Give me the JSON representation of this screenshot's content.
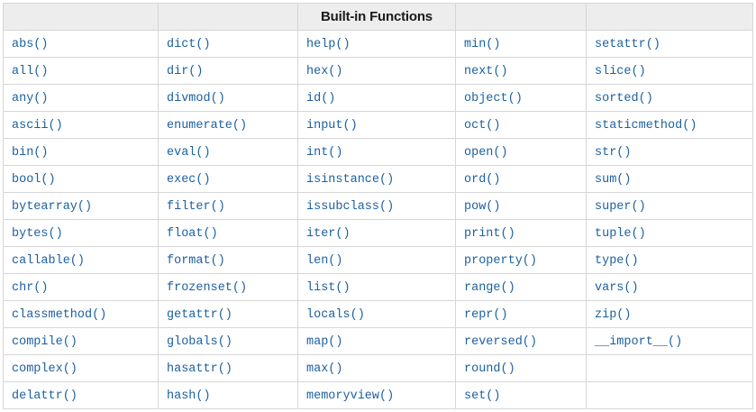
{
  "table": {
    "title": "Built-in Functions",
    "link_color": "#1c60a0",
    "header_background": "#ededed",
    "border_color": "#d6d6d6",
    "rows": [
      [
        "abs()",
        "dict()",
        "help()",
        "min()",
        "setattr()"
      ],
      [
        "all()",
        "dir()",
        "hex()",
        "next()",
        "slice()"
      ],
      [
        "any()",
        "divmod()",
        "id()",
        "object()",
        "sorted()"
      ],
      [
        "ascii()",
        "enumerate()",
        "input()",
        "oct()",
        "staticmethod()"
      ],
      [
        "bin()",
        "eval()",
        "int()",
        "open()",
        "str()"
      ],
      [
        "bool()",
        "exec()",
        "isinstance()",
        "ord()",
        "sum()"
      ],
      [
        "bytearray()",
        "filter()",
        "issubclass()",
        "pow()",
        "super()"
      ],
      [
        "bytes()",
        "float()",
        "iter()",
        "print()",
        "tuple()"
      ],
      [
        "callable()",
        "format()",
        "len()",
        "property()",
        "type()"
      ],
      [
        "chr()",
        "frozenset()",
        "list()",
        "range()",
        "vars()"
      ],
      [
        "classmethod()",
        "getattr()",
        "locals()",
        "repr()",
        "zip()"
      ],
      [
        "compile()",
        "globals()",
        "map()",
        "reversed()",
        "__import__()"
      ],
      [
        "complex()",
        "hasattr()",
        "max()",
        "round()",
        ""
      ],
      [
        "delattr()",
        "hash()",
        "memoryview()",
        "set()",
        ""
      ]
    ]
  }
}
